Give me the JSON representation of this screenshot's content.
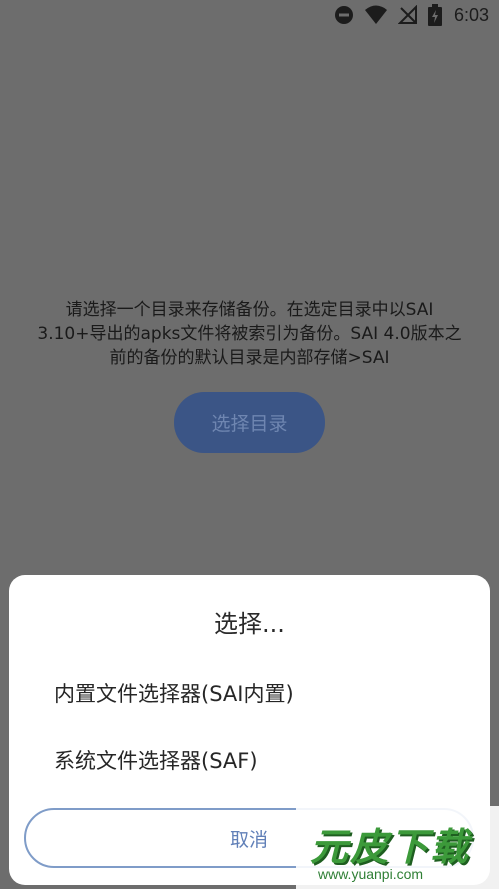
{
  "status_bar": {
    "time": "6:03",
    "icons": [
      "do-not-disturb-icon",
      "wifi-icon",
      "no-signal-icon",
      "battery-icon"
    ]
  },
  "message": {
    "lines": [
      "请选择一个目录来存储备份。在选定目录中以SAI",
      "3.10+导出的apks文件将被索引为备份。SAI 4.0版本之",
      "前的备份的默认目录是内部存储>SAI"
    ]
  },
  "primary_button": {
    "label": "选择目录"
  },
  "dialog": {
    "title": "选择...",
    "options": [
      "内置文件选择器(SAI内置)",
      "系统文件选择器(SAF)"
    ],
    "cancel_label": "取消"
  },
  "watermark": {
    "logo_text": "元皮下载",
    "url": "www.yuanpi.com"
  },
  "colors": {
    "scrim": "#6d6d6d",
    "primary_button": "#3b5586",
    "accent": "#6180b8",
    "watermark_green": "#3c9a3a"
  }
}
